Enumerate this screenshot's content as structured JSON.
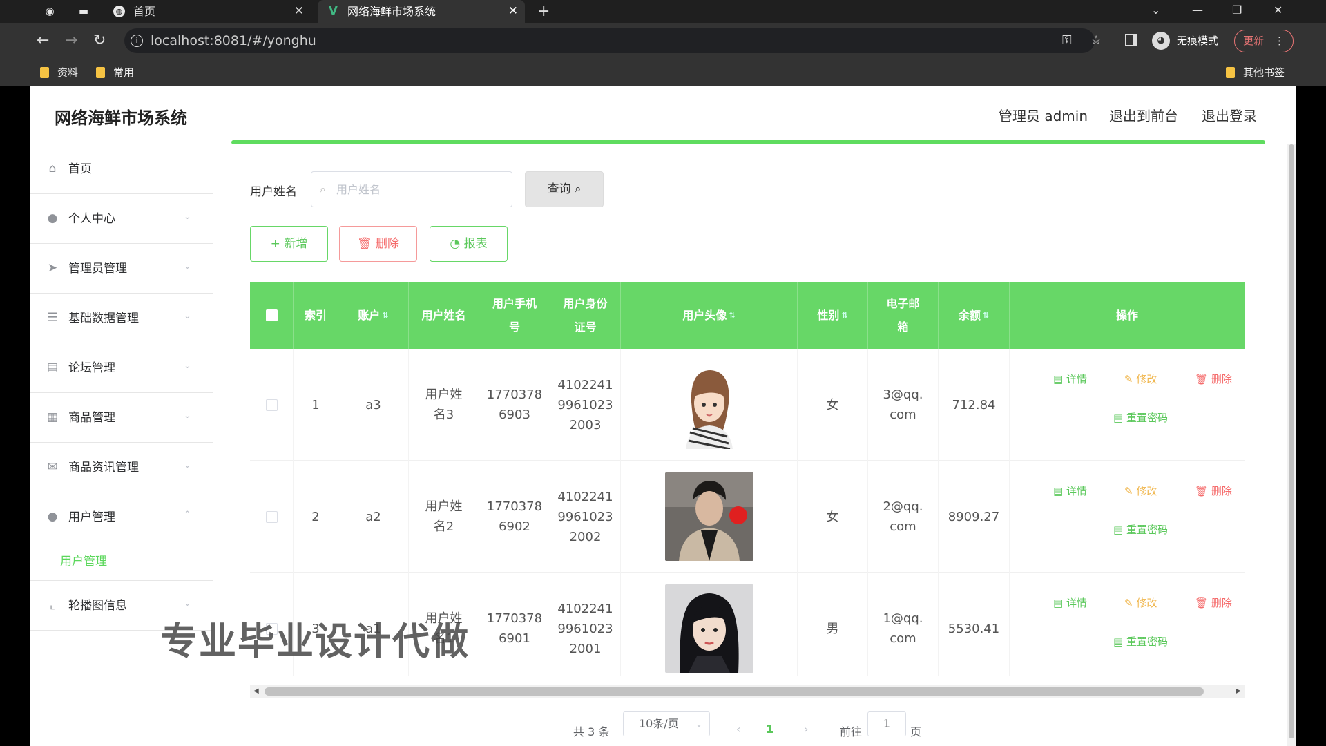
{
  "browser": {
    "tabs": [
      {
        "title": "首页"
      },
      {
        "title": "网络海鲜市场系统"
      }
    ],
    "url": "localhost:8081/#/yonghu",
    "incognito_label": "无痕模式",
    "update_label": "更新",
    "bookmarks": [
      "资料",
      "常用"
    ],
    "other_bookmarks": "其他书签"
  },
  "header": {
    "title": "网络海鲜市场系统",
    "admin_label": "管理员 admin",
    "exit_front": "退出到前台",
    "logout": "退出登录"
  },
  "sidebar": {
    "items": [
      {
        "label": "首页",
        "icon": "home-icon"
      },
      {
        "label": "个人中心",
        "icon": "user-icon"
      },
      {
        "label": "管理员管理",
        "icon": "send-icon"
      },
      {
        "label": "基础数据管理",
        "icon": "sliders-icon"
      },
      {
        "label": "论坛管理",
        "icon": "clipboard-icon"
      },
      {
        "label": "商品管理",
        "icon": "grid-icon"
      },
      {
        "label": "商品资讯管理",
        "icon": "mail-icon"
      },
      {
        "label": "用户管理",
        "icon": "location-icon"
      },
      {
        "label": "轮播图信息",
        "icon": "crop-icon"
      }
    ],
    "active_sub": "用户管理"
  },
  "search": {
    "label": "用户姓名",
    "placeholder": "用户姓名",
    "query_label": "查询"
  },
  "actions": {
    "add": "新增",
    "delete": "删除",
    "report": "报表"
  },
  "table": {
    "headers": {
      "index": "索引",
      "account": "账户",
      "name": "用户姓名",
      "phone": "用户手机号",
      "id_card": "用户身份证号",
      "avatar": "用户头像",
      "gender": "性别",
      "email": "电子邮箱",
      "balance": "余额",
      "ops": "操作"
    },
    "rows": [
      {
        "index": "1",
        "account": "a3",
        "name": "用户姓名3",
        "phone": "17703786903",
        "id_card": "410224199610232003",
        "gender": "女",
        "email": "3@qq.com",
        "balance": "712.84"
      },
      {
        "index": "2",
        "account": "a2",
        "name": "用户姓名2",
        "phone": "17703786902",
        "id_card": "410224199610232002",
        "gender": "女",
        "email": "2@qq.com",
        "balance": "8909.27"
      },
      {
        "index": "3",
        "account": "a1",
        "name": "用户姓名1",
        "phone": "17703786901",
        "id_card": "410224199610232001",
        "gender": "男",
        "email": "1@qq.com",
        "balance": "5530.41"
      }
    ],
    "ops": {
      "detail": "详情",
      "edit": "修改",
      "delete": "删除",
      "reset": "重置密码"
    }
  },
  "pagination": {
    "total": "共 3 条",
    "page_size": "10条/页",
    "current": "1",
    "goto_prefix": "前往",
    "goto_value": "1",
    "goto_suffix": "页"
  },
  "watermark": "专业毕业设计代做",
  "colors": {
    "accent": "#67d767",
    "danger": "#f56c6c",
    "warning": "#f0b54a"
  }
}
